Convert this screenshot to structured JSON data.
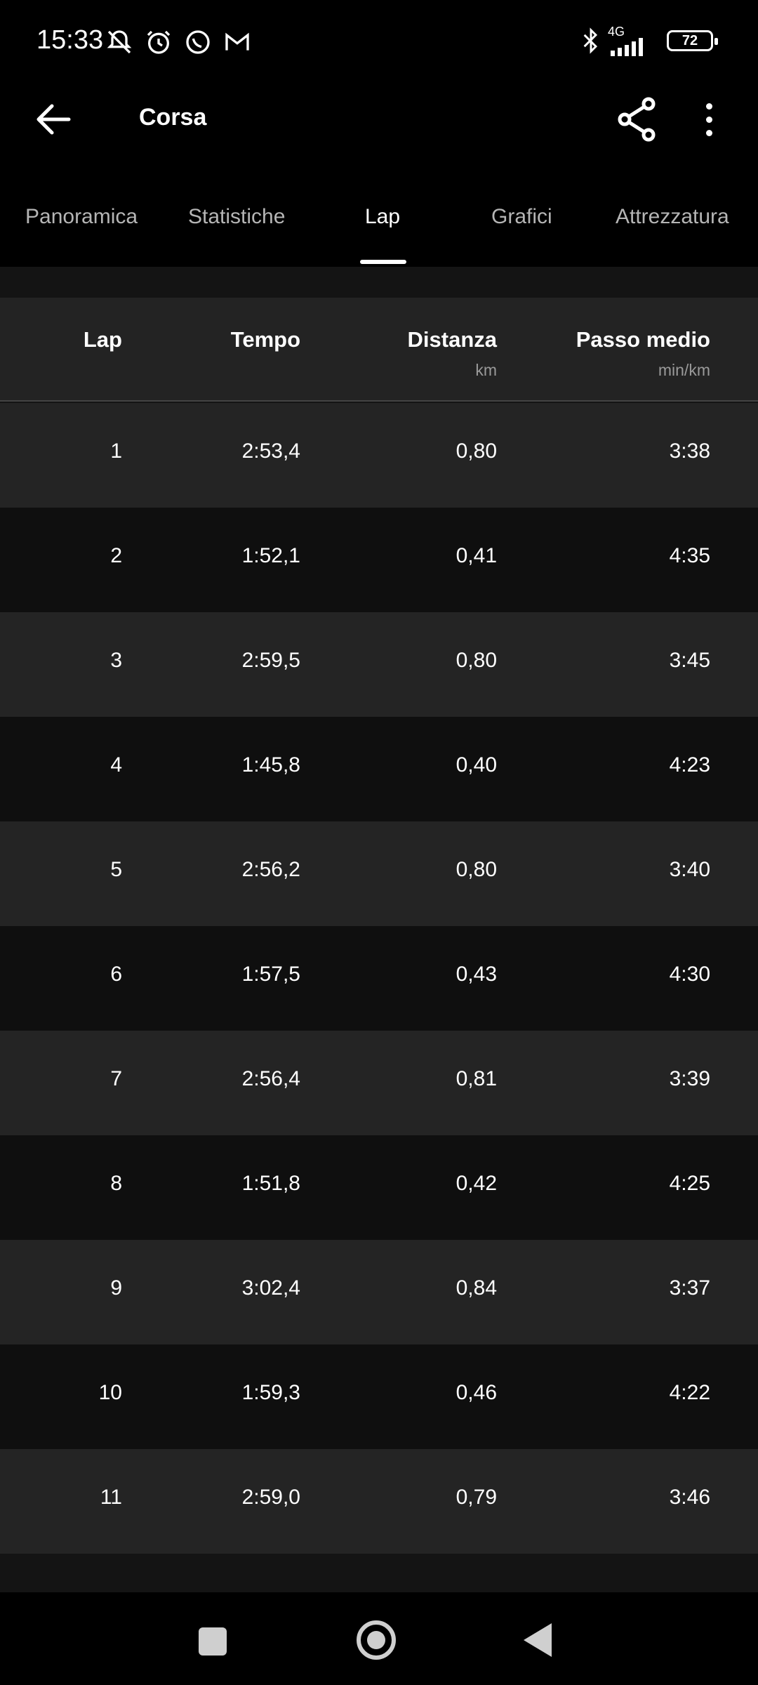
{
  "status_bar": {
    "time": "15:33",
    "network": "4G",
    "battery": "72"
  },
  "app_bar": {
    "title": "Corsa"
  },
  "tabs": [
    {
      "label": "Panoramica",
      "active": false
    },
    {
      "label": "Statistiche",
      "active": false
    },
    {
      "label": "Lap",
      "active": true
    },
    {
      "label": "Grafici",
      "active": false
    },
    {
      "label": "Attrezzatura",
      "active": false
    }
  ],
  "table": {
    "headers": {
      "lap": "Lap",
      "time": "Tempo",
      "distance": "Distanza",
      "distance_unit": "km",
      "pace": "Passo medio",
      "pace_unit": "min/km"
    },
    "rows": [
      {
        "lap": "1",
        "time": "2:53,4",
        "distance": "0,80",
        "pace": "3:38"
      },
      {
        "lap": "2",
        "time": "1:52,1",
        "distance": "0,41",
        "pace": "4:35"
      },
      {
        "lap": "3",
        "time": "2:59,5",
        "distance": "0,80",
        "pace": "3:45"
      },
      {
        "lap": "4",
        "time": "1:45,8",
        "distance": "0,40",
        "pace": "4:23"
      },
      {
        "lap": "5",
        "time": "2:56,2",
        "distance": "0,80",
        "pace": "3:40"
      },
      {
        "lap": "6",
        "time": "1:57,5",
        "distance": "0,43",
        "pace": "4:30"
      },
      {
        "lap": "7",
        "time": "2:56,4",
        "distance": "0,81",
        "pace": "3:39"
      },
      {
        "lap": "8",
        "time": "1:51,8",
        "distance": "0,42",
        "pace": "4:25"
      },
      {
        "lap": "9",
        "time": "3:02,4",
        "distance": "0,84",
        "pace": "3:37"
      },
      {
        "lap": "10",
        "time": "1:59,3",
        "distance": "0,46",
        "pace": "4:22"
      },
      {
        "lap": "11",
        "time": "2:59,0",
        "distance": "0,79",
        "pace": "3:46"
      }
    ]
  },
  "icons": {
    "back": "arrow-back-icon",
    "share": "share-icon",
    "more": "more-vert-icon"
  }
}
